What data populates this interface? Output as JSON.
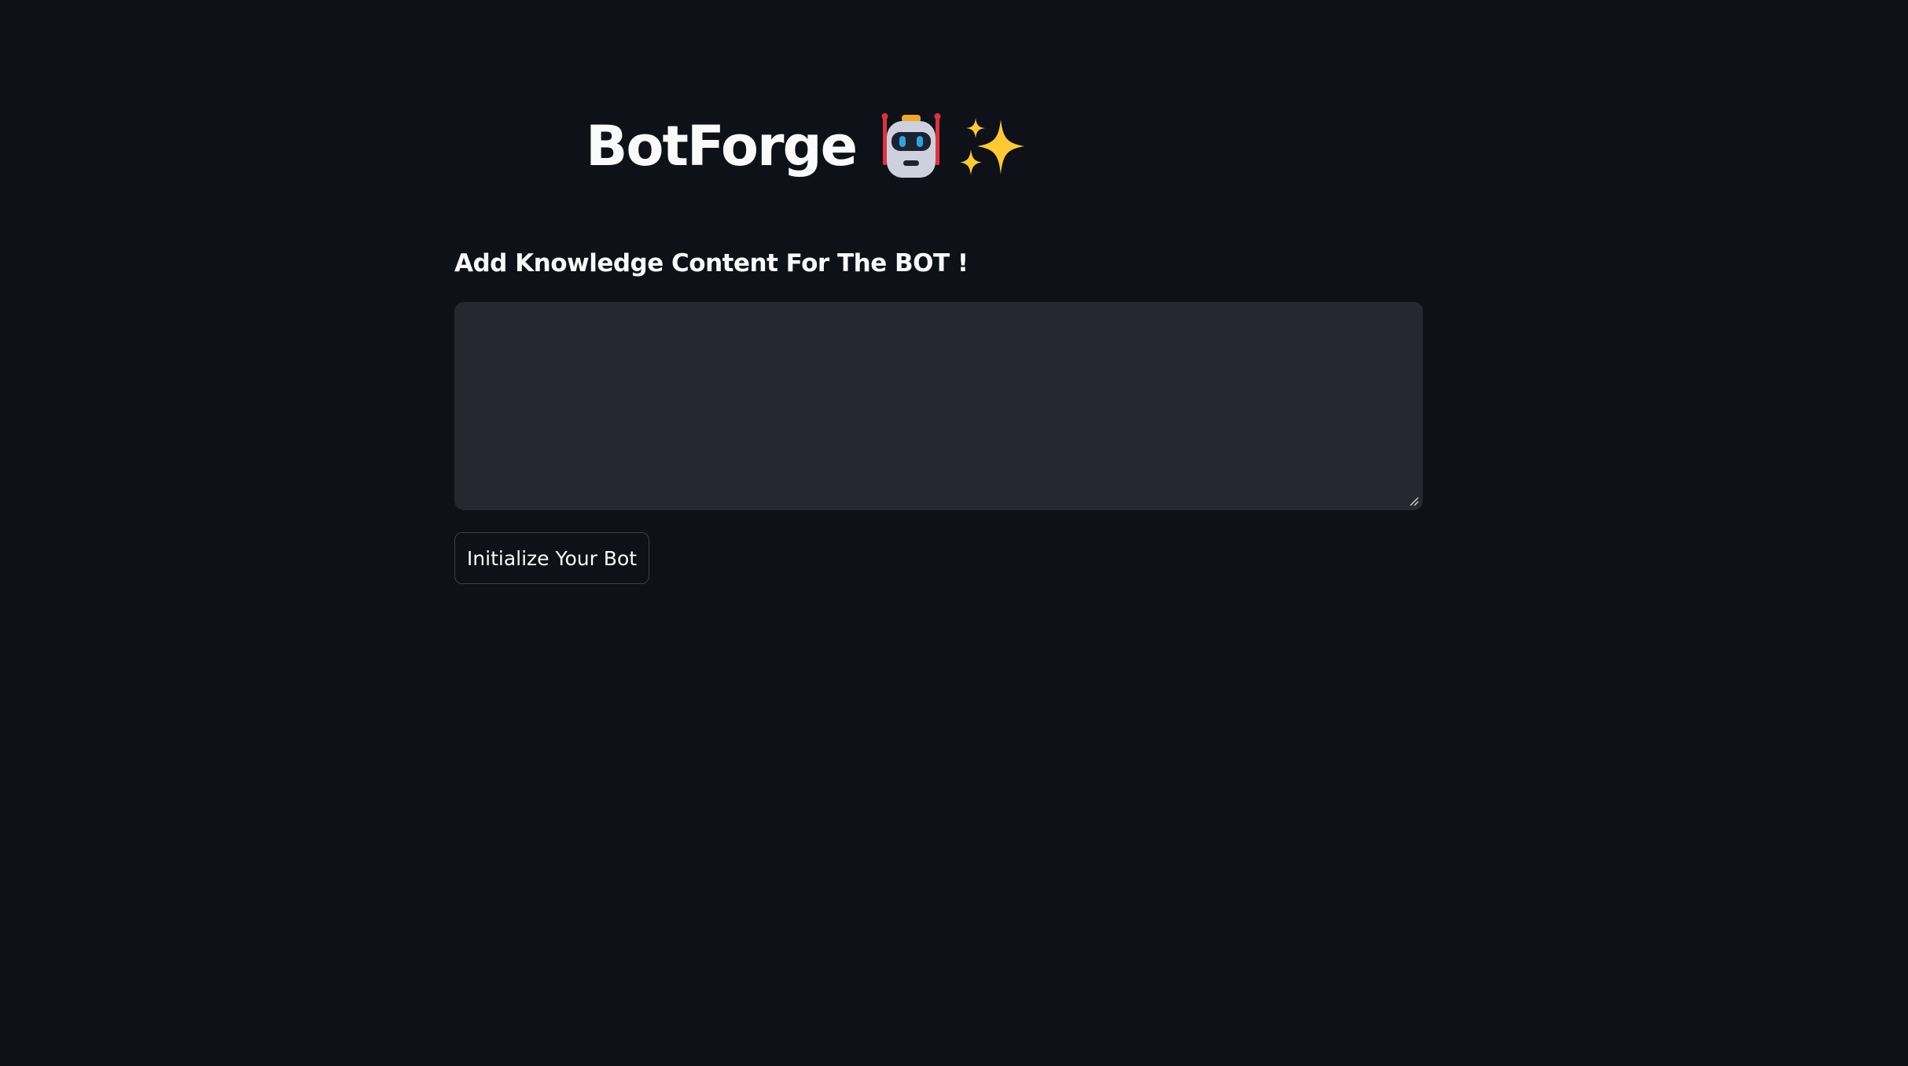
{
  "app": {
    "title": "BotForge",
    "title_icons": [
      "robot-icon",
      "sparkles-icon"
    ]
  },
  "form": {
    "heading": "Add Knowledge Content For The BOT !",
    "knowledge_input_value": "",
    "submit_label": "Initialize Your Bot"
  },
  "colors": {
    "background": "#0e1118",
    "input_background": "#262730",
    "text": "#fafafa",
    "button_border": "#3d3f4b",
    "sparkle": "#ffc933",
    "robot_antenna": "#e0323c",
    "robot_eyes": "#2aa6e5"
  }
}
